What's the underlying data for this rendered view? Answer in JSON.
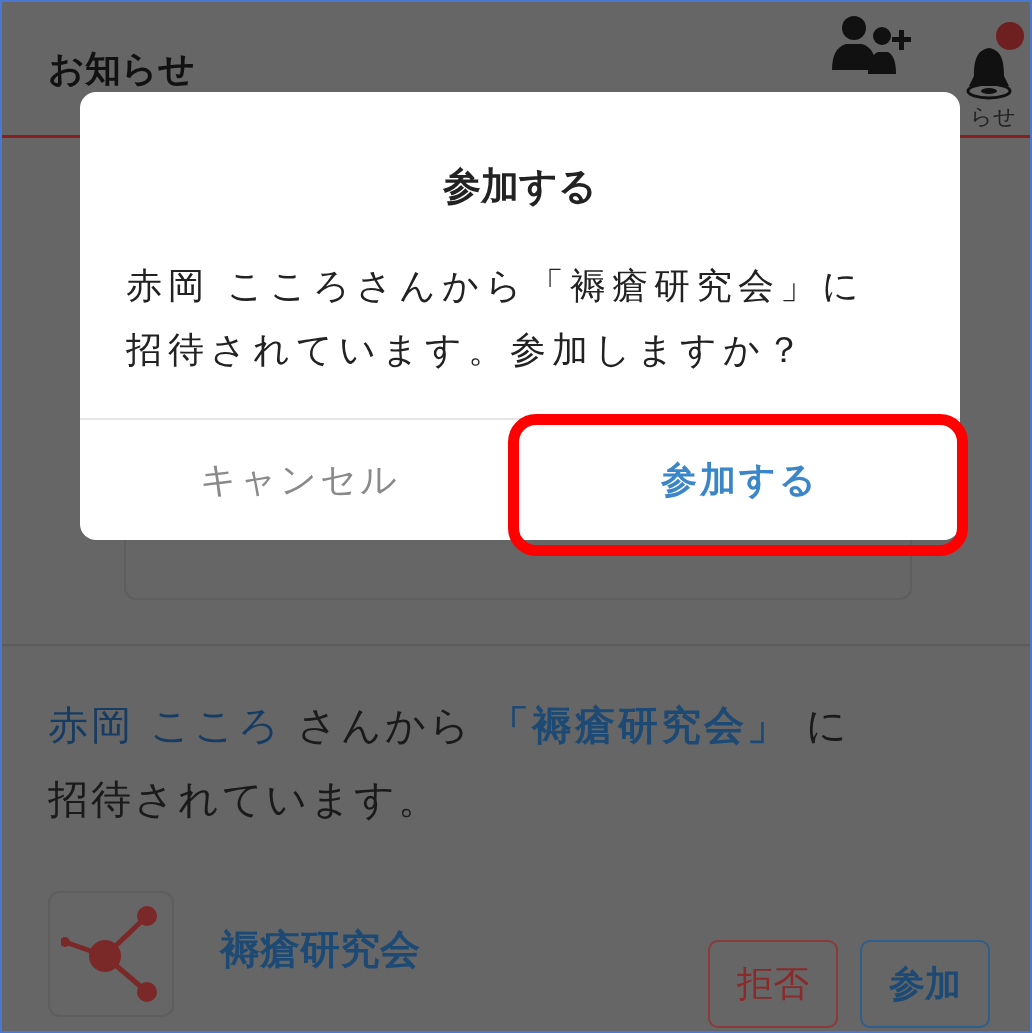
{
  "header": {
    "title": "お知らせ",
    "notification_label": "らせ",
    "unread": true
  },
  "invitation": {
    "segments": [
      {
        "kind": "person",
        "text": "赤岡 こころ"
      },
      {
        "kind": "plain",
        "text": " さんから "
      },
      {
        "kind": "group",
        "text": "「褥瘡研究会」"
      },
      {
        "kind": "plain",
        "text": " に招待されています。"
      }
    ],
    "group_name": "褥瘡研究会",
    "decline_label": "拒否",
    "join_label": "参加"
  },
  "dialog": {
    "title": "参加する",
    "message": "赤岡 こころさんから「褥瘡研究会」に招待されています。参加しますか？",
    "buttons": [
      {
        "label": "キャンセル",
        "kind": "cancel",
        "highlighted": false
      },
      {
        "label": "参加する",
        "kind": "confirm",
        "highlighted": true
      }
    ]
  }
}
